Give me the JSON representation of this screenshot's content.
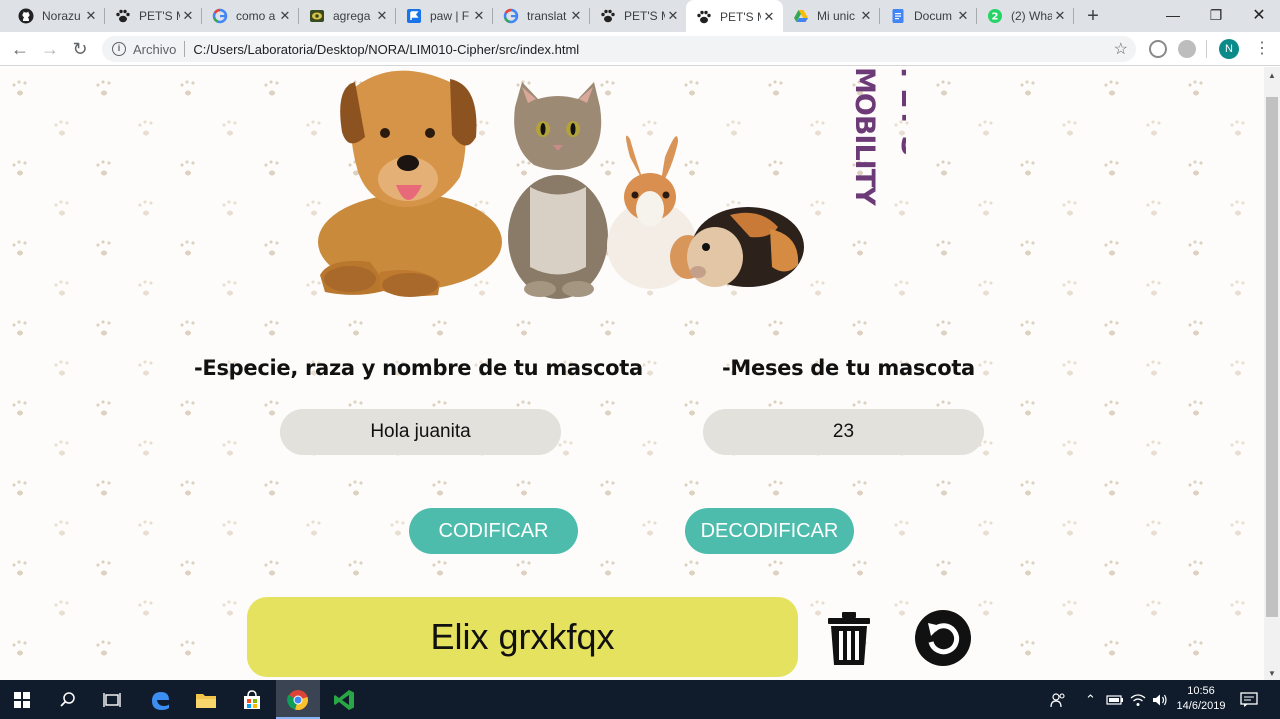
{
  "browser": {
    "tabs": [
      {
        "title": "Norazu",
        "icon": "github-icon"
      },
      {
        "title": "PET'S M",
        "icon": "paw-icon"
      },
      {
        "title": "como a",
        "icon": "google-icon"
      },
      {
        "title": "agrega",
        "icon": "image-icon"
      },
      {
        "title": "paw | F",
        "icon": "flag-icon"
      },
      {
        "title": "translat",
        "icon": "google-icon"
      },
      {
        "title": "PET'S M",
        "icon": "paw-icon"
      },
      {
        "title": "PET'S M",
        "icon": "paw-icon",
        "active": true
      },
      {
        "title": "Mi unic",
        "icon": "drive-icon"
      },
      {
        "title": "Docum",
        "icon": "docs-icon"
      },
      {
        "title": "(2) Wha",
        "icon": "whatsapp-icon"
      }
    ],
    "new_tab_label": "+",
    "omnibox": {
      "scheme_label": "Archivo",
      "url": "C:/Users/Laboratoria/Desktop/NORA/LIM010-Cipher/src/index.html"
    },
    "profile_initial": "N"
  },
  "app": {
    "brand_text": "PET'S MOBILITY",
    "species_label": "-Especie, raza y nombre de tu mascota",
    "months_label": "-Meses de tu mascota",
    "message_value": "Hola juanita",
    "months_value": "23",
    "encode_label": "CODIFICAR",
    "decode_label": "DECODIFICAR",
    "result_text": "Elix grxkfqx",
    "accent_color": "#4dbcad",
    "result_color": "#e4e25e",
    "brand_color": "#6d3a78"
  },
  "taskbar": {
    "time": "10:56",
    "date": "14/6/2019"
  }
}
